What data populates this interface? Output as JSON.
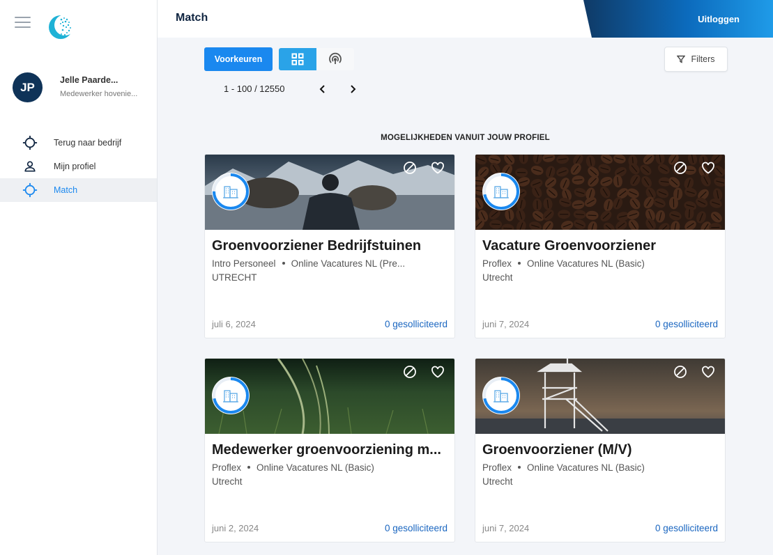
{
  "sidebar": {
    "user": {
      "initials": "JP",
      "name": "Jelle Paarde...",
      "role": "Medewerker hovenie..."
    },
    "nav": [
      {
        "label": "Terug naar bedrijf",
        "icon": "crosshair-icon"
      },
      {
        "label": "Mijn profiel",
        "icon": "person-icon"
      },
      {
        "label": "Match",
        "icon": "crosshair-icon",
        "active": true
      }
    ]
  },
  "header": {
    "title": "Match",
    "logout_label": "Uitloggen"
  },
  "toolbar": {
    "preferences_label": "Voorkeuren",
    "filters_label": "Filters",
    "pagination": "1 - 100 / 12550"
  },
  "section_title": "MOGELIJKHEDEN VANUIT JOUW PROFIEL",
  "colors": {
    "primary": "#1a88ef",
    "navy": "#0f3358",
    "link": "#1a66c0",
    "toggle_active": "#2aa3e8"
  },
  "cards": [
    {
      "title": "Groenvoorziener Bedrijfstuinen",
      "company": "Intro Personeel",
      "source": "Online Vacatures NL (Pre...",
      "location": "UTRECHT",
      "date": "juli 6, 2024",
      "applied": "0 gesolliciteerd",
      "match": 0.75
    },
    {
      "title": "Vacature Groenvoorziener",
      "company": "Proflex",
      "source": "Online Vacatures NL (Basic)",
      "location": "Utrecht",
      "date": "juni 7, 2024",
      "applied": "0 gesolliciteerd",
      "match": 0.72
    },
    {
      "title": "Medewerker groenvoorziening m...",
      "company": "Proflex",
      "source": "Online Vacatures NL (Basic)",
      "location": "Utrecht",
      "date": "juni 2, 2024",
      "applied": "0 gesolliciteerd",
      "match": 0.72
    },
    {
      "title": "Groenvoorziener (M/V)",
      "company": "Proflex",
      "source": "Online Vacatures NL (Basic)",
      "location": "Utrecht",
      "date": "juni 7, 2024",
      "applied": "0 gesolliciteerd",
      "match": 0.72
    }
  ]
}
